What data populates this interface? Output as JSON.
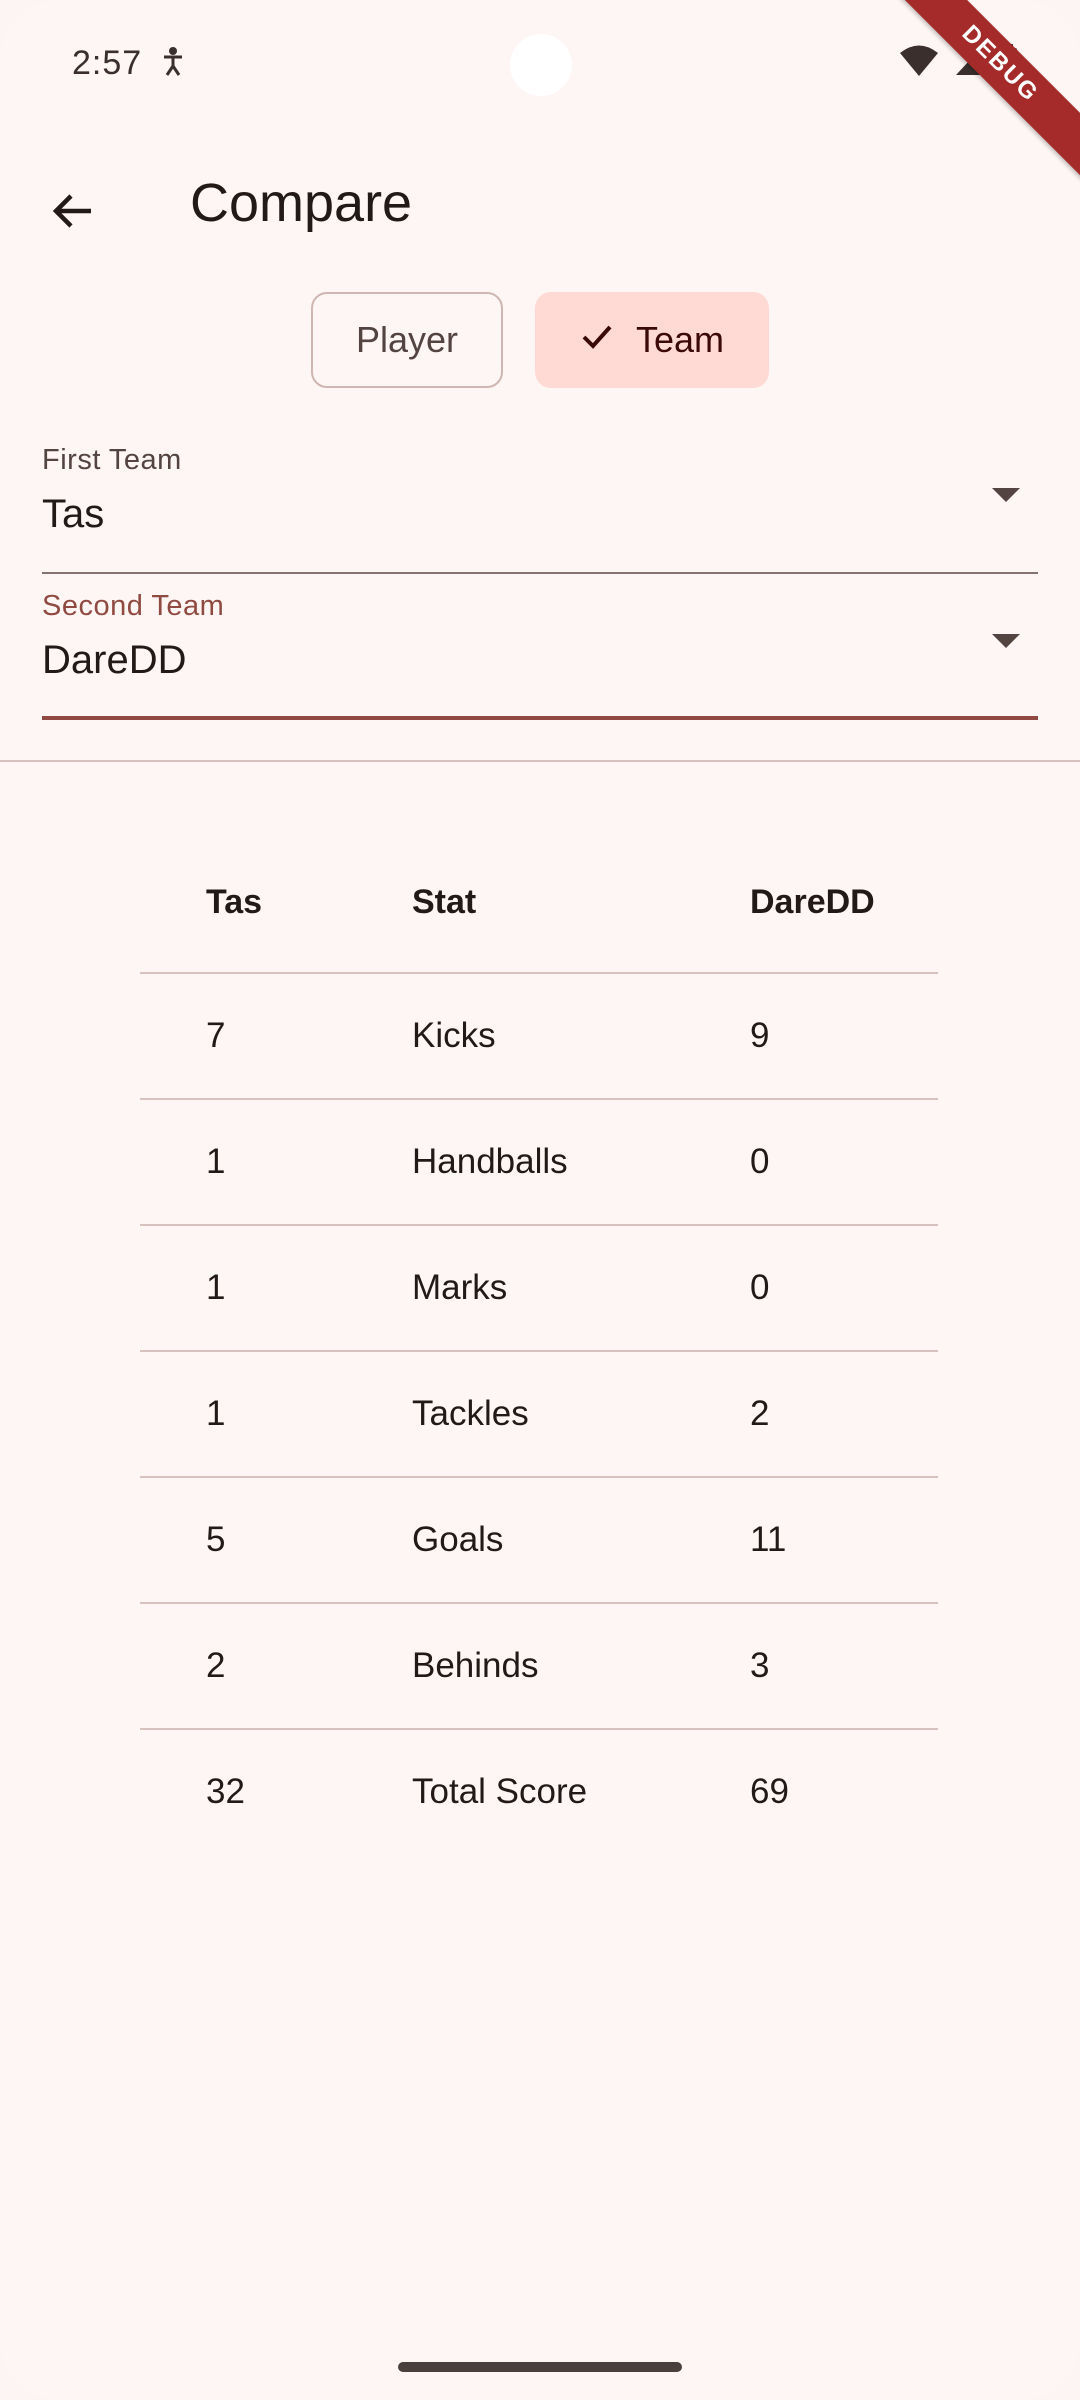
{
  "status_bar": {
    "time": "2:57",
    "debug_label": "DEBUG"
  },
  "app_bar": {
    "title": "Compare"
  },
  "mode_chips": {
    "player_label": "Player",
    "team_label": "Team",
    "selected": "Team"
  },
  "first_team": {
    "label": "First Team",
    "value": "Tas"
  },
  "second_team": {
    "label": "Second Team",
    "value": "DareDD"
  },
  "table": {
    "headers": [
      "Tas",
      "Stat",
      "DareDD"
    ],
    "rows": [
      [
        "7",
        "Kicks",
        "9"
      ],
      [
        "1",
        "Handballs",
        "0"
      ],
      [
        "1",
        "Marks",
        "0"
      ],
      [
        "1",
        "Tackles",
        "2"
      ],
      [
        "5",
        "Goals",
        "11"
      ],
      [
        "2",
        "Behinds",
        "3"
      ],
      [
        "32",
        "Total Score",
        "69"
      ]
    ]
  },
  "colors": {
    "background": "#fef6f4",
    "primary": "#904a42",
    "selected_chip": "#ffdad5",
    "debug_ribbon": "#a52a2a"
  }
}
